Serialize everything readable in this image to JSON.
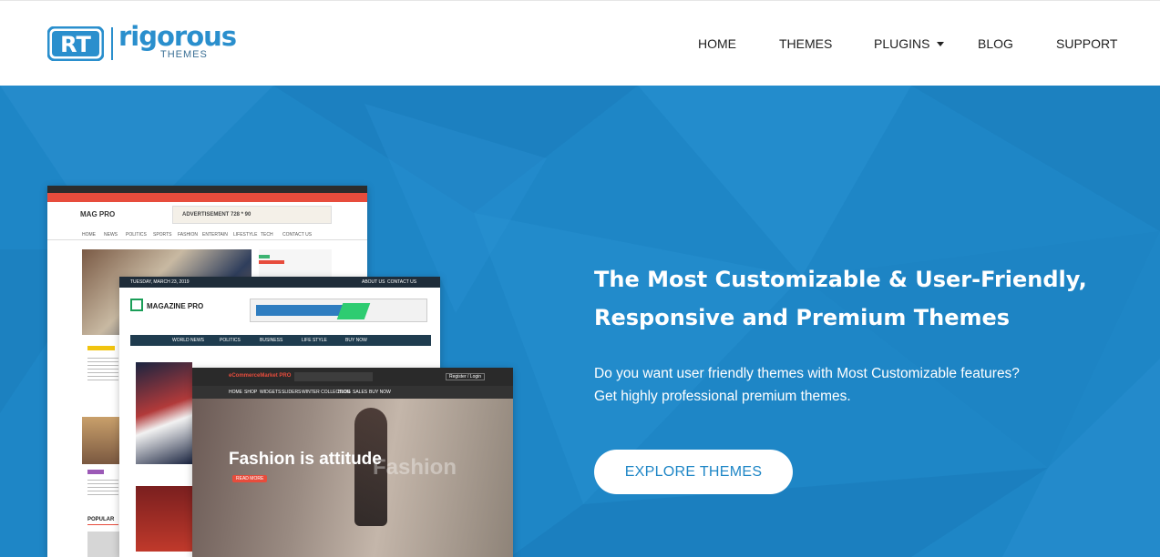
{
  "brand": {
    "logo_mark": "RT",
    "name": "rigorous",
    "sub": "THEMES"
  },
  "nav": {
    "items": [
      {
        "label": "HOME"
      },
      {
        "label": "THEMES"
      },
      {
        "label": "PLUGINS"
      },
      {
        "label": "BLOG"
      },
      {
        "label": "SUPPORT"
      }
    ]
  },
  "hero": {
    "title_line1": "The Most Customizable & User-Friendly,",
    "title_line2": "Responsive and Premium Themes",
    "desc_line1": "Do you want user friendly themes with Most Customizable features?",
    "desc_line2": "Get highly professional premium themes.",
    "cta_label": "EXPLORE THEMES"
  },
  "mockups": {
    "shot1": {
      "brand": "MAG PRO",
      "ad": "ADVERTISEMENT 728 * 90",
      "menu": [
        "HOME",
        "NEWS",
        "POLITICS",
        "SPORTS",
        "FASHION",
        "ENTERTAIN",
        "LIFESTYLE",
        "TECH",
        "CONTACT US"
      ],
      "popular": "POPULAR"
    },
    "shot2": {
      "date": "TUESDAY, MARCH 23, 2019",
      "links": [
        "ABOUT US",
        "CONTACT US"
      ],
      "brand": "MAGAZINE PRO",
      "menu": [
        "WORLD NEWS",
        "POLITICS",
        "BUSINESS",
        "LIFE STYLE",
        "BUY NOW"
      ]
    },
    "shot3": {
      "brand": "eCommerceMarket PRO",
      "menu": [
        "HOME",
        "SHOP",
        "WIDGETS",
        "SLIDERS",
        "WINTER COLLECTION",
        "BLOG",
        "SALES",
        "BUY NOW"
      ],
      "login": "Register / Login",
      "headline": "Fashion is attitude",
      "ghost": "Fashion",
      "read_more": "READ MORE"
    }
  },
  "colors": {
    "brand_blue": "#1e86c6",
    "logo_blue": "#2a8fcd",
    "red_bar": "#e74c3c"
  }
}
